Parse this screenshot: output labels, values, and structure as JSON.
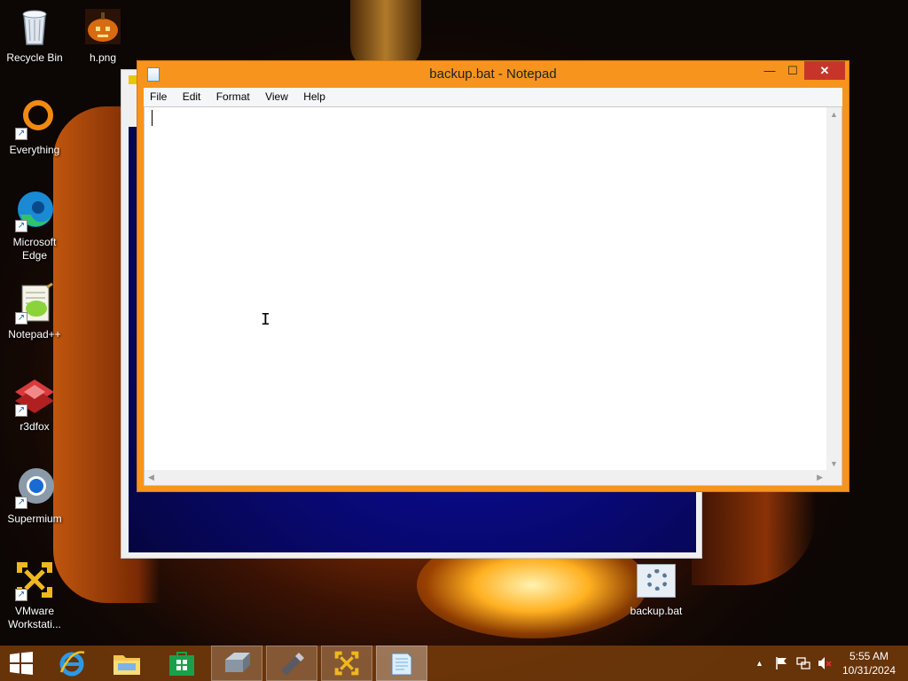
{
  "desktop": {
    "icons": [
      {
        "label": "Recycle Bin",
        "icon": "recycle-bin-icon"
      },
      {
        "label": "h.png",
        "icon": "image-file-icon"
      },
      {
        "label": "Everything",
        "icon": "everything-icon"
      },
      {
        "label": "Microsoft Edge",
        "icon": "edge-icon"
      },
      {
        "label": "Notepad++",
        "icon": "notepadpp-icon"
      },
      {
        "label": "r3dfox",
        "icon": "r3dfox-icon"
      },
      {
        "label": "Supermium",
        "icon": "supermium-icon"
      },
      {
        "label": "VMware Workstati...",
        "icon": "vmware-icon"
      },
      {
        "label": "backup.bat",
        "icon": "batch-file-icon"
      }
    ]
  },
  "notepad": {
    "title": "backup.bat - Notepad",
    "menu": [
      "File",
      "Edit",
      "Format",
      "View",
      "Help"
    ],
    "content": "",
    "controls": {
      "minimize": "minimize-icon",
      "maximize": "maximize-icon",
      "close": "close-icon"
    }
  },
  "taskbar": {
    "items": [
      {
        "icon": "start-icon"
      },
      {
        "icon": "internet-explorer-icon"
      },
      {
        "icon": "file-explorer-icon"
      },
      {
        "icon": "store-icon"
      },
      {
        "icon": "drive-icon"
      },
      {
        "icon": "usb-drive-icon"
      },
      {
        "icon": "vmware-icon"
      },
      {
        "icon": "notepad-icon"
      }
    ],
    "tray": {
      "icons": [
        "show-hidden-icons",
        "flag-icon",
        "network-icon",
        "volume-muted-icon"
      ],
      "time": "5:55 AM",
      "date": "10/31/2024"
    }
  },
  "colors": {
    "notepad_frame": "#f7941d",
    "close_button": "#c7352a",
    "taskbar": "#783c0a"
  }
}
